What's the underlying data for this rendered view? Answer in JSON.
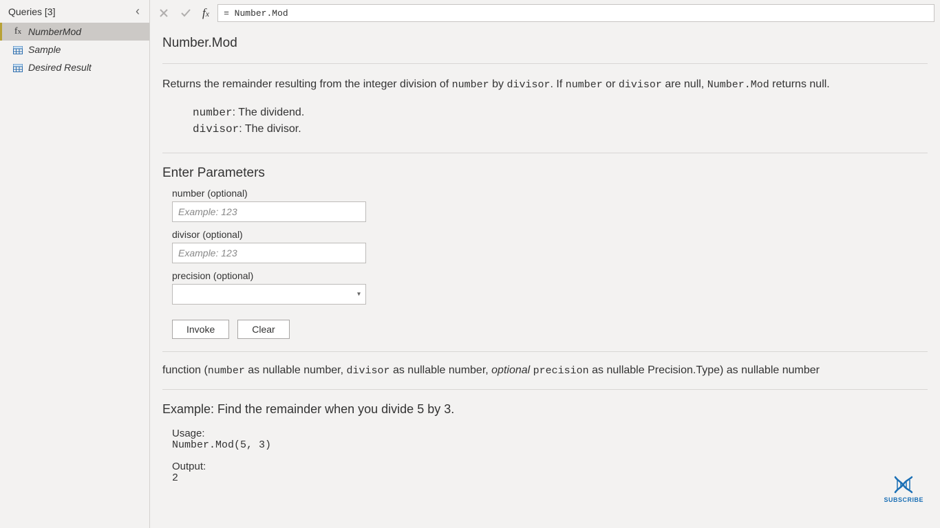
{
  "sidebar": {
    "header": "Queries [3]",
    "items": [
      {
        "label": "NumberMod",
        "icon": "fx",
        "active": true
      },
      {
        "label": "Sample",
        "icon": "table",
        "active": false
      },
      {
        "label": "Desired Result",
        "icon": "table",
        "active": false
      }
    ]
  },
  "formula_bar": {
    "value": "= Number.Mod"
  },
  "doc": {
    "title": "Number.Mod",
    "description_pre": "Returns the remainder resulting from the integer division of ",
    "desc_code1": "number",
    "desc_mid1": " by ",
    "desc_code2": "divisor",
    "desc_mid2": ". If ",
    "desc_code3": "number",
    "desc_mid3": " or ",
    "desc_code4": "divisor",
    "desc_mid4": " are null, ",
    "desc_code5": "Number.Mod",
    "desc_end": " returns null.",
    "params": [
      {
        "name": "number",
        "desc": ": The dividend."
      },
      {
        "name": "divisor",
        "desc": ": The divisor."
      }
    ],
    "enter_params_title": "Enter Parameters",
    "fields": {
      "number_label": "number (optional)",
      "number_placeholder": "Example: 123",
      "divisor_label": "divisor (optional)",
      "divisor_placeholder": "Example: 123",
      "precision_label": "precision (optional)"
    },
    "buttons": {
      "invoke": "Invoke",
      "clear": "Clear"
    },
    "signature": {
      "text1": "function (",
      "p1": "number",
      "t2": " as nullable number, ",
      "p2": "divisor",
      "t3": " as nullable number, ",
      "opt": "optional",
      "sp": " ",
      "p3": "precision",
      "t4": " as nullable Precision.Type) as nullable number"
    },
    "example": {
      "title": "Example: Find the remainder when you divide 5 by 3.",
      "usage_label": "Usage:",
      "usage_code": "Number.Mod(5, 3)",
      "output_label": "Output:",
      "output_value": "2"
    }
  },
  "watermark": {
    "label": "SUBSCRIBE"
  }
}
